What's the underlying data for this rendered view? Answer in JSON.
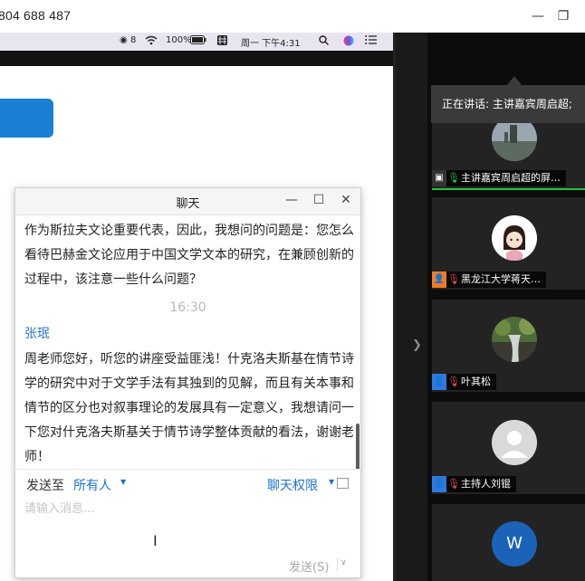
{
  "window": {
    "id_display": "804 688 487"
  },
  "mac_menubar": {
    "battery": "100%",
    "date_time": "周一 下午4:31",
    "badge_count": "8"
  },
  "chat": {
    "title": "聊天",
    "message1": "作为斯拉夫文论重要代表，因此，我想问的问题是：您怎么看待巴赫金文论应用于中国文学文本的研究，在兼顾创新的过程中，该注意一些什么问题？",
    "timestamp": "16:30",
    "sender": "张珉",
    "message2": "周老师您好，听您的讲座受益匪浅！什克洛夫斯基在情节诗学的研究中对于文学手法有其独到的见解，而且有关本事和情节的区分也对叙事理论的发展具有一定意义，我想请问一下您对什克洛夫斯基关于情节诗学整体贡献的看法，谢谢老师！",
    "send_to_label": "发送至",
    "send_to_value": "所有人",
    "permissions_label": "聊天权限",
    "input_placeholder": "请输入消息...",
    "send_label": "发送(S)"
  },
  "speaking_banner": "正在讲话: 主讲嘉宾周启超;",
  "participants": [
    {
      "name": "主讲嘉宾周启超的屏…",
      "mic_state": "on",
      "avatar": "photo-landscape-icon"
    },
    {
      "name": "黑龙江大学蒋天…",
      "mic_state": "muted",
      "avatar": "cartoon-girl-icon"
    },
    {
      "name": "叶其松",
      "mic_state": "muted",
      "avatar": "photo-waterfall-icon"
    },
    {
      "name": "主持人刘锟",
      "mic_state": "muted",
      "avatar": "default-user-icon"
    },
    {
      "name": "",
      "mic_state": "",
      "avatar_letter": "W"
    }
  ],
  "colors": {
    "accent_blue": "#1a73c9",
    "speaker_green": "#1fc14a",
    "tile_bg": "#232323"
  }
}
